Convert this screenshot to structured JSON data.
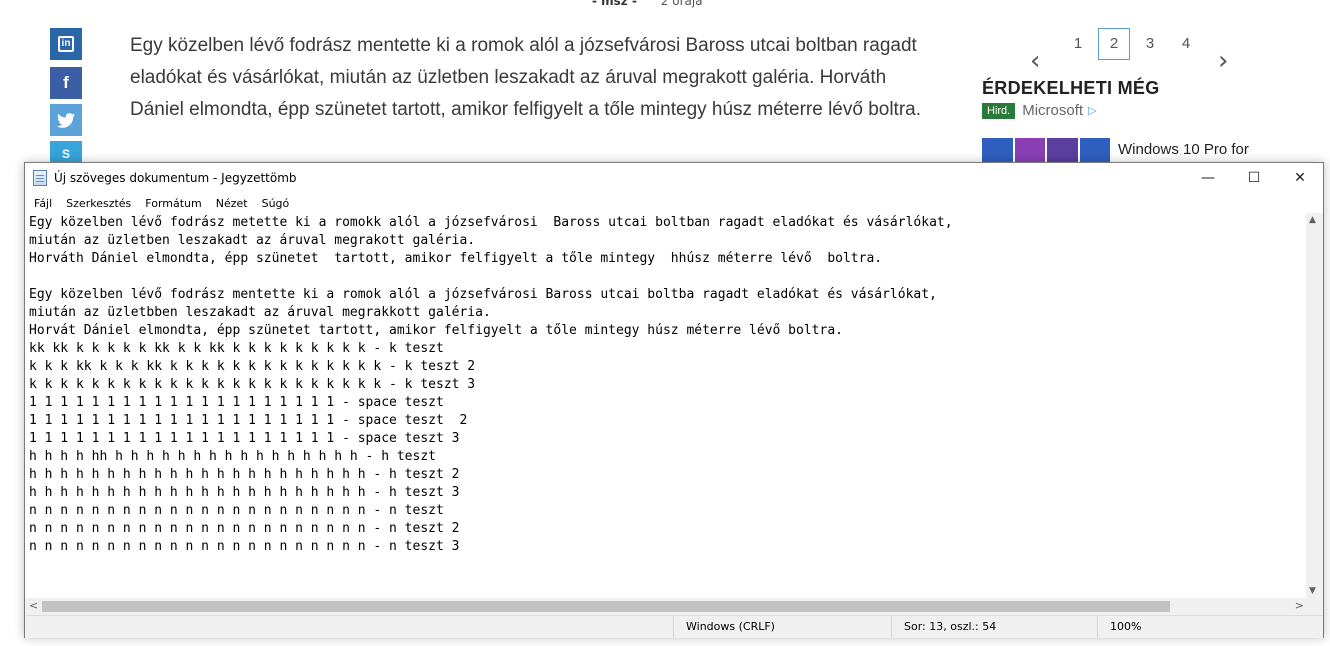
{
  "web": {
    "byline": {
      "author": "- msz -",
      "time": "2 órája"
    },
    "share": {
      "linkedin": "in",
      "facebook": "f",
      "skype": "S"
    },
    "article_text": "Egy közelben lévő fodrász mentette ki a romok alól a józsefvárosi Baross utcai boltban ragadt eladókat és vásárlókat, miután az üzletben leszakadt az áruval megrakott galéria. Horváth Dániel elmondta, épp szünetet tartott, amikor felfigyelt a tőle mintegy húsz méterre lévő boltra.",
    "pager": {
      "prev": "‹",
      "next": "›",
      "pages": [
        "1",
        "2",
        "3",
        "4"
      ],
      "active": "2"
    },
    "sidebar": {
      "heading": "ÉRDEKELHETI MÉG",
      "ad_badge": "Hird.",
      "ad_source": "Microsoft",
      "ad_play": "▷",
      "ad_title": "Windows 10 Pro for"
    }
  },
  "notepad": {
    "title": "Új szöveges dokumentum - Jegyzettömb",
    "controls": {
      "minimize": "—",
      "maximize": "☐",
      "close": "✕"
    },
    "menu": [
      "Fájl",
      "Szerkesztés",
      "Formátum",
      "Nézet",
      "Súgó"
    ],
    "lines": [
      "Egy közelben lévő fodrász metette ki a romokk alól a józsefvárosi  Baross utcai boltban ragadt eladókat és vásárlókat,",
      "miután az üzletben leszakadt az áruval megrakott galéria.",
      "Horváth Dániel elmondta, épp szünetet  tartott, amikor felfigyelt a tőle mintegy  hhúsz méterre lévő  boltra.",
      "",
      "Egy közelben lévő fodrász mentette ki a romok alól a józsefvárosi Baross utcai boltba ragadt eladókat és vásárlókat,",
      "miután az üzletbben leszakadt az áruval megrakkott galéria.",
      "Horvát Dániel elmondta, épp szünetet tartott, amikor felfigyelt a tőle mintegy húsz méterre lévő boltra.",
      "kk kk k k k k k kk k k kk k k k k k k k k k - k teszt",
      "k k k kk k k k kk k k k k k k k k k k k k k k - k teszt 2",
      "k k k k k k k k k k k k k k k k k k k k k k k - k teszt 3",
      "1 1 1 1 1 1 1 1 1 1 1 1 1 1 1 1 1 1 1 1 - space teszt",
      "1 1 1 1 1 1 1 1 1 1 1 1 1 1 1 1 1 1 1 1 - space teszt  2",
      "1 1 1 1 1 1 1 1 1 1 1 1 1 1 1 1 1 1 1 1 - space teszt 3",
      "h h h h hh h h h h h h h h h h h h h h h h - h teszt",
      "h h h h h h h h h h h h h h h h h h h h h h - h teszt 2",
      "h h h h h h h h h h h h h h h h h h h h h h - h teszt 3",
      "n n n n n n n n n n n n n n n n n n n n n n - n teszt",
      "n n n n n n n n n n n n n n n n n n n n n n - n teszt 2",
      "n n n n n n n n n n n n n n n n n n n n n n - n teszt 3"
    ],
    "status": {
      "eol": "Windows (CRLF)",
      "position": "Sor: 13, oszl.: 54",
      "zoom": "100%"
    },
    "scroll_arrows": {
      "up": "▲",
      "down": "▼",
      "left": "<",
      "right": ">"
    }
  }
}
